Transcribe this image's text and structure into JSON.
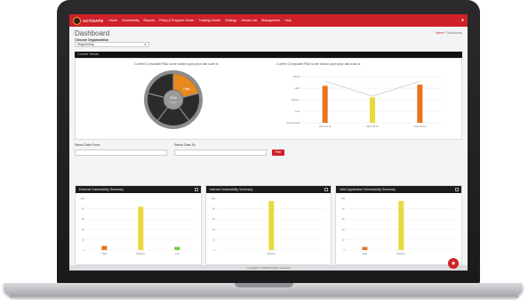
{
  "app": {
    "logo_text": "ACTIVATE",
    "nav": [
      "Home",
      "Vulnerability",
      "Reports",
      "Policy & Program Center",
      "Training Center",
      "Settings",
      "Vendor List",
      "Management",
      "Help"
    ],
    "accent_color": "#cf2129"
  },
  "page": {
    "title": "Dashboard",
    "breadcrumb_home": "Home",
    "breadcrumb_sep": "/",
    "breadcrumb_current": "Dashboard",
    "org_label": "Choose Organization",
    "org_value": "Waypointing"
  },
  "risk": {
    "section_label": "Current Trends",
    "wheel_caption": "Current Composite Risk score based upon your last scan is",
    "wheel_center": "Risk",
    "wheel_center_sub": "Level",
    "wheel_highlight": "High",
    "line_caption": "Current Composite Risk score based upon your last scan is",
    "chart_data": {
      "type": "bar",
      "categories": [
        "2021-04-12",
        "2021-05-12",
        "2021-06-12"
      ],
      "y_tick_labels": [
        "Critical",
        "High",
        "Medium",
        "Low",
        "Informational"
      ],
      "values": [
        3.2,
        2.2,
        3.3
      ],
      "line_values": [
        3.6,
        2.3,
        3.6
      ],
      "bar_colors": [
        "#e8741e",
        "#e8d93c",
        "#e8741e"
      ]
    }
  },
  "filter": {
    "from_label": "Select Date From:",
    "to_label": "Select Date To:",
    "go_label": "Filter"
  },
  "vuln_panels": [
    {
      "title": "External Vulnerability Summary",
      "chart_data": {
        "type": "bar",
        "categories": [
          "High",
          "Medium",
          "Low"
        ],
        "values": [
          8,
          84,
          6
        ],
        "colors": [
          "#e8741e",
          "#e8d93c",
          "#6ec644"
        ],
        "ylim": [
          0,
          100
        ]
      }
    },
    {
      "title": "Internal Vulnerability Summary",
      "chart_data": {
        "type": "bar",
        "categories": [
          "Medium"
        ],
        "values": [
          95
        ],
        "colors": [
          "#e8d93c"
        ],
        "ylim": [
          0,
          100
        ]
      }
    },
    {
      "title": "Web Application Vulnerability Summary",
      "chart_data": {
        "type": "bar",
        "categories": [
          "High",
          "Medium"
        ],
        "values": [
          6,
          95
        ],
        "colors": [
          "#e8741e",
          "#e8d93c"
        ],
        "ylim": [
          0,
          100
        ]
      }
    }
  ],
  "footer_text": "Copyright © 2023 All rights reserved"
}
